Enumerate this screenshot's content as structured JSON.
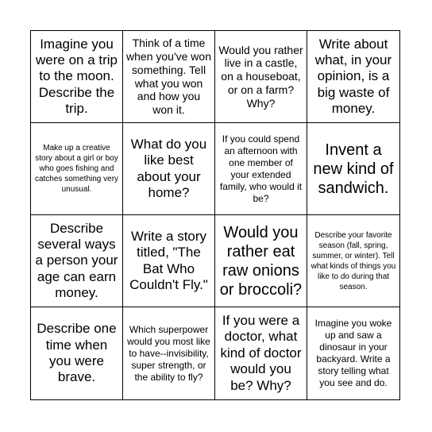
{
  "board": {
    "cells": [
      "Imagine you were on a trip to the moon. Describe the trip.",
      "Think of a time when you've won something. Tell what you won and how you won it.",
      "Would you rather live in a castle, on a houseboat, or on a farm? Why?",
      "Write about what, in your opinion, is a big waste of money.",
      "Make up a creative story about a girl or boy who goes fishing and catches something very unusual.",
      "What do you like best about your home?",
      "If you could spend an afternoon with one member of your extended family, who would it be?",
      "Invent a new kind of sandwich.",
      "Describe several ways a person your age can earn money.",
      "Write a story titled, \"The Bat Who Couldn't Fly.\"",
      "Would you rather eat raw onions or broccoli?",
      "Describe your favorite season (fall, spring, summer, or winter). Tell what kinds of things you like to do during that season.",
      "Describe one time when you were brave.",
      "Which superpower would you most like to have--invisibility, super strength, or the ability to fly?",
      "If you were a doctor, what kind of doctor would you be? Why?",
      "Imagine you woke up and saw a dinosaur in your backyard. Write a story telling what you see and do."
    ]
  }
}
